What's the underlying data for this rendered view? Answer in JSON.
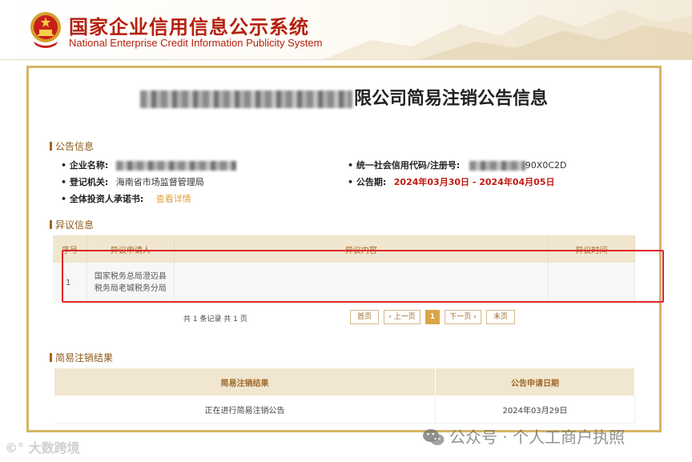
{
  "header": {
    "title_cn": "国家企业信用信息公示系统",
    "title_en": "National Enterprise Credit Information Publicity System",
    "emblem_icon": "national-emblem-icon"
  },
  "notice": {
    "title_visible": "限公司简易注销公告信息"
  },
  "announcement": {
    "section_title": "公告信息",
    "company_name_label": "企业名称:",
    "credit_code_label": "统一社会信用代码/注册号:",
    "credit_code_visible": "90X0C2D",
    "registration_authority_label": "登记机关:",
    "registration_authority": "海南省市场监督管理局",
    "notice_period_label": "公告期:",
    "notice_period": "2024年03月30日 - 2024年04月05日",
    "investor_commitment_label": "全体投资人承诺书:",
    "investor_commitment_link": "查看详情"
  },
  "objection": {
    "section_title": "异议信息",
    "columns": [
      "序号",
      "异议申请人",
      "异议内容",
      "异议时间"
    ],
    "rows": [
      {
        "no": "1",
        "applicant": "国家税务总局澄迈县税务局老城税务分局",
        "content": "",
        "time": ""
      }
    ]
  },
  "pagination": {
    "summary": "共 1 条记录 共 1 页",
    "first": "首页",
    "prev": "‹ 上一页",
    "current": "1",
    "next": "下一页 ›",
    "last": "末页"
  },
  "result": {
    "section_title": "简易注销结果",
    "columns": [
      "简易注销结果",
      "公告申请日期"
    ],
    "rows": [
      {
        "result": "正在进行简易注销公告",
        "date": "2024年03月29日"
      }
    ]
  },
  "watermarks": {
    "left": "大数跨境",
    "right": "公众号 · 个人工商户执照"
  },
  "colors": {
    "brand_red": "#b5200f",
    "frame_gold": "#d6b466",
    "highlight_red": "#e0262b",
    "table_header_bg": "#f1e6cf"
  }
}
